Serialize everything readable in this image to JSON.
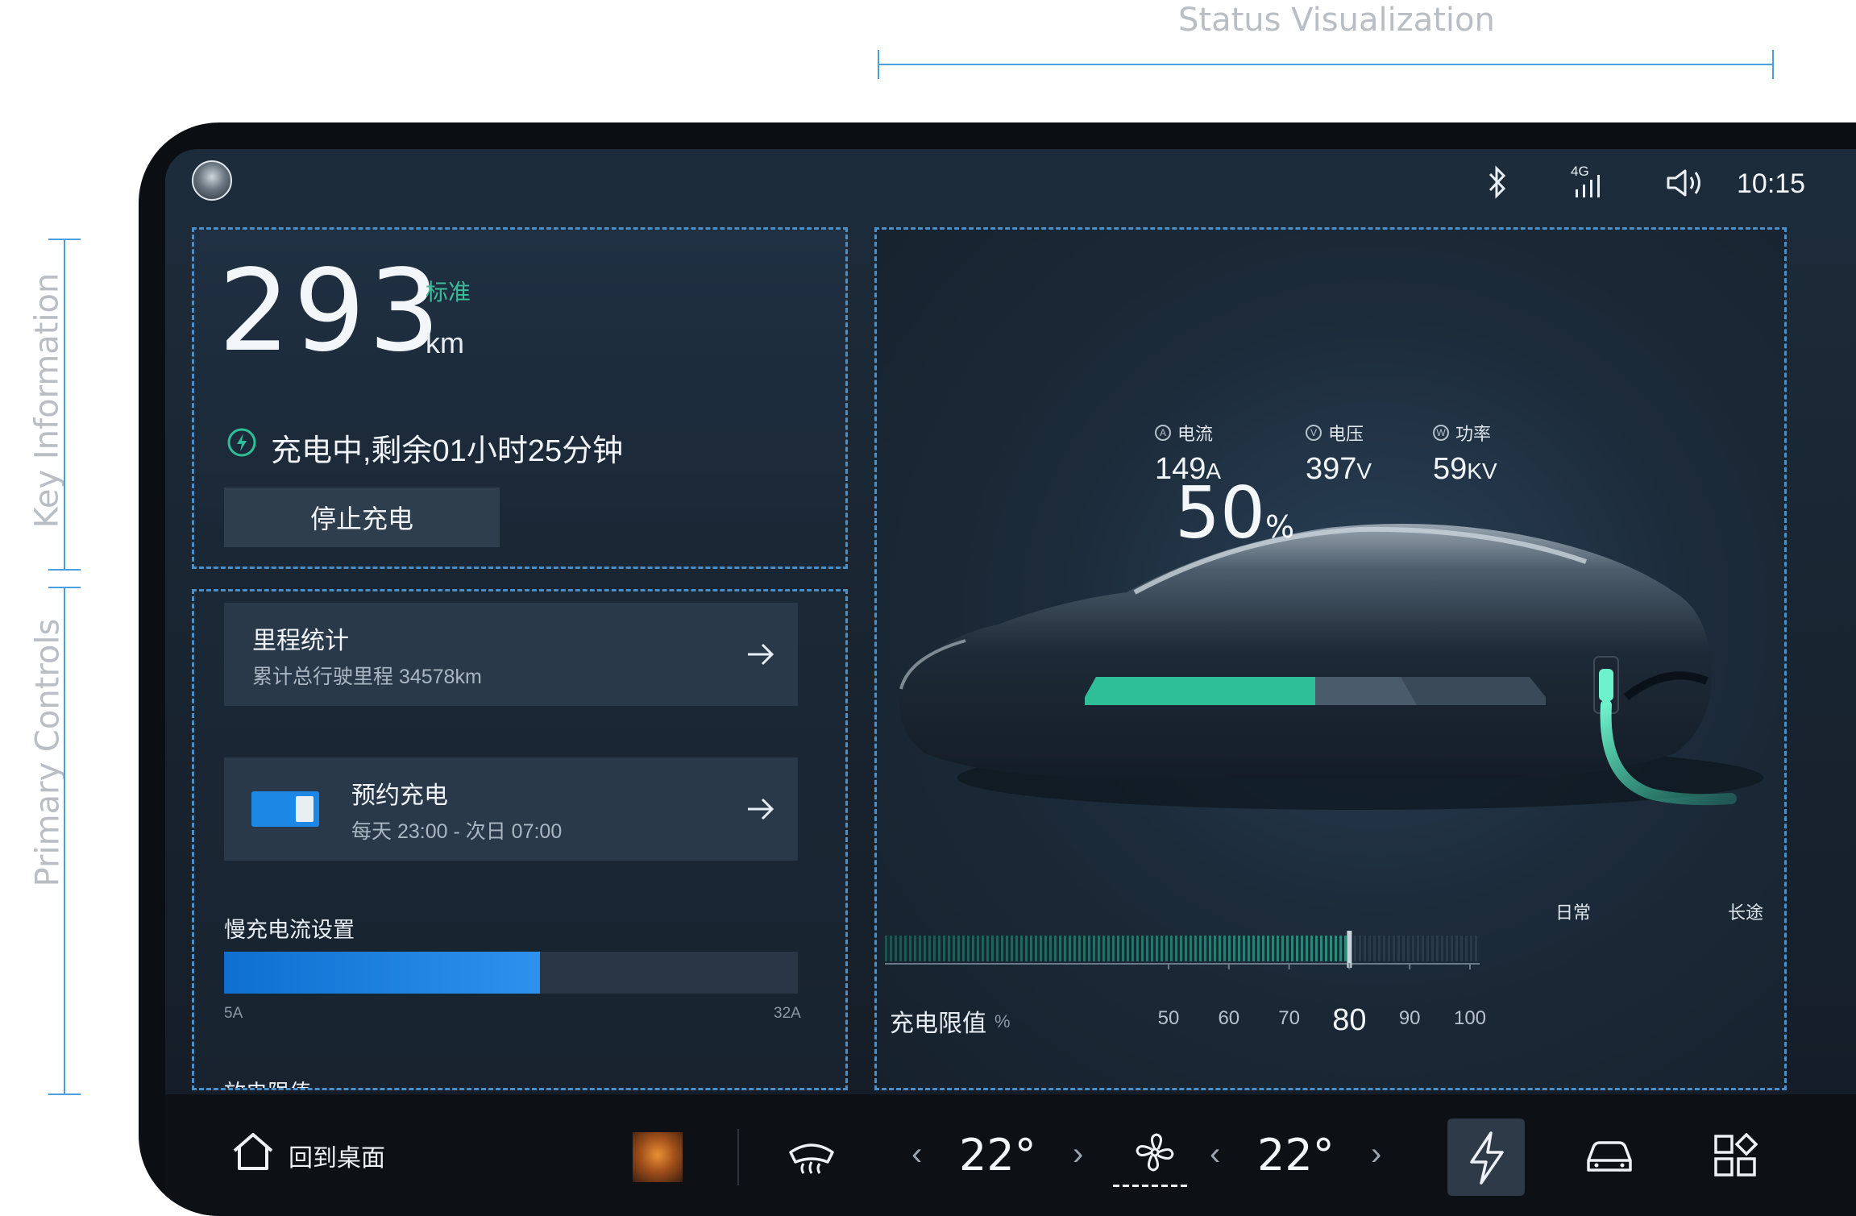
{
  "annotations": {
    "status_visualization": "Status Visualization",
    "key_information": "Key Information",
    "primary_controls": "Primary Controls"
  },
  "statusbar": {
    "time": "10:15",
    "network": "4G",
    "icons": [
      "avatar",
      "bluetooth-icon",
      "signal-icon",
      "volume-icon"
    ]
  },
  "range": {
    "value": "293",
    "mode": "标准",
    "unit": "km",
    "charging_status": "充电中,剩余01小时25分钟",
    "stop_button": "停止充电"
  },
  "cards": {
    "mileage": {
      "title": "里程统计",
      "subtitle": "累计总行驶里程 34578km"
    },
    "schedule": {
      "title": "预约充电",
      "subtitle": "每天 23:00 - 次日 07:00",
      "enabled": true
    }
  },
  "slow_charge": {
    "label": "慢充电流设置",
    "min": "5A",
    "max": "32A",
    "level": 0.55
  },
  "discharge_limit": {
    "label": "放电限值"
  },
  "metrics": {
    "current": {
      "badge": "A",
      "label": "电流",
      "value": "149",
      "unit": "A"
    },
    "voltage": {
      "badge": "V",
      "label": "电压",
      "value": "397",
      "unit": "V"
    },
    "power": {
      "badge": "W",
      "label": "功率",
      "value": "59",
      "unit": "KV"
    }
  },
  "battery": {
    "percent": "50",
    "unit": "%",
    "level": 0.5,
    "charging_color": "#2fbf98"
  },
  "charge_limit": {
    "label": "充电限值",
    "unit": "%",
    "scale": [
      "50",
      "60",
      "70",
      "80",
      "90",
      "100"
    ],
    "selected": "80",
    "mode_daily": "日常",
    "mode_long": "长途"
  },
  "bottombar": {
    "home_label": "回到桌面",
    "temp_left": "22°",
    "temp_right": "22°",
    "icons": [
      "home-icon",
      "album-cover",
      "rear-defrost-icon",
      "fan-icon",
      "charging-icon",
      "car-icon",
      "apps-icon"
    ]
  },
  "colors": {
    "accent": "#1d87e6",
    "charge_green": "#2fbf98",
    "dashed": "#4a8fc8"
  }
}
